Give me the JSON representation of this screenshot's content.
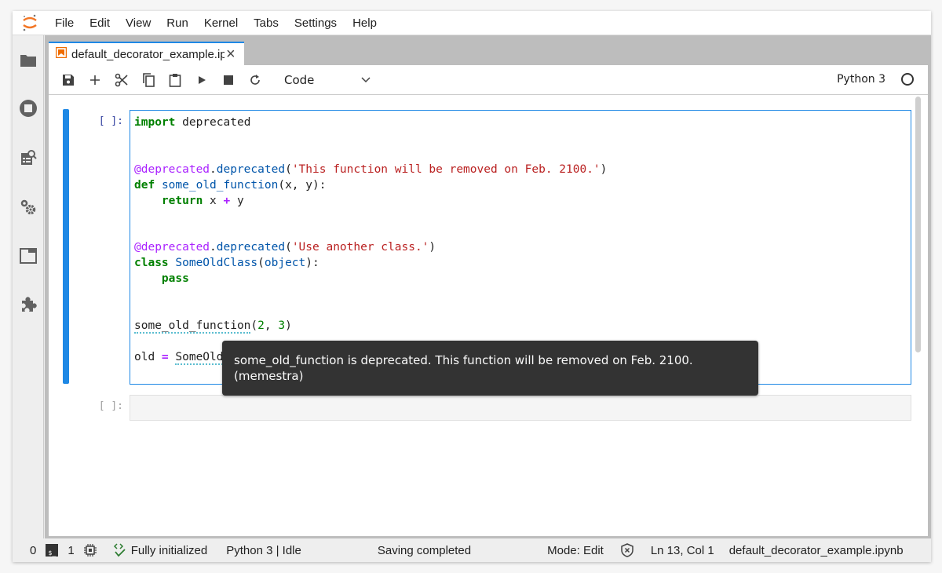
{
  "menubar": {
    "items": [
      "File",
      "Edit",
      "View",
      "Run",
      "Kernel",
      "Tabs",
      "Settings",
      "Help"
    ]
  },
  "sidebar": {
    "icons": [
      "folder-icon",
      "running-stop-icon",
      "property-inspector-icon",
      "settings-gears-icon",
      "tabs-icon",
      "extension-puzzle-icon"
    ]
  },
  "tab": {
    "title": "default_decorator_example.ipynb",
    "close_symbol": "×"
  },
  "toolbar": {
    "cell_type": "Code",
    "kernel_name": "Python 3"
  },
  "cells": [
    {
      "prompt": "[ ]:",
      "lines": [
        "import deprecated",
        "",
        "",
        "@deprecated.deprecated('This function will be removed on Feb. 2100.')",
        "def some_old_function(x, y):",
        "    return x + y",
        "",
        "",
        "@deprecated.deprecated('Use another class.')",
        "class SomeOldClass(object):",
        "    pass",
        "",
        "",
        "some_old_function(2, 3)",
        "",
        "old = SomeOldClass()"
      ]
    },
    {
      "prompt": "[ ]:",
      "lines": []
    }
  ],
  "tooltip": {
    "line1": "some_old_function is deprecated. This function will be removed on Feb. 2100.",
    "line2": "(memestra)"
  },
  "statusbar": {
    "terminals_count": "0",
    "terminal_icon_text": "$_",
    "kernels_count": "1",
    "lsp_status": "Fully initialized",
    "kernel_status": "Python 3 | Idle",
    "save_status": "Saving completed",
    "mode": "Mode: Edit",
    "cursor_position": "Ln 13, Col 1",
    "filename": "default_decorator_example.ipynb"
  },
  "colors": {
    "accent": "#1e88e5",
    "logo_orange": "#f37726",
    "lsp_green": "#2e7d32",
    "tooltip_bg": "#333333"
  }
}
